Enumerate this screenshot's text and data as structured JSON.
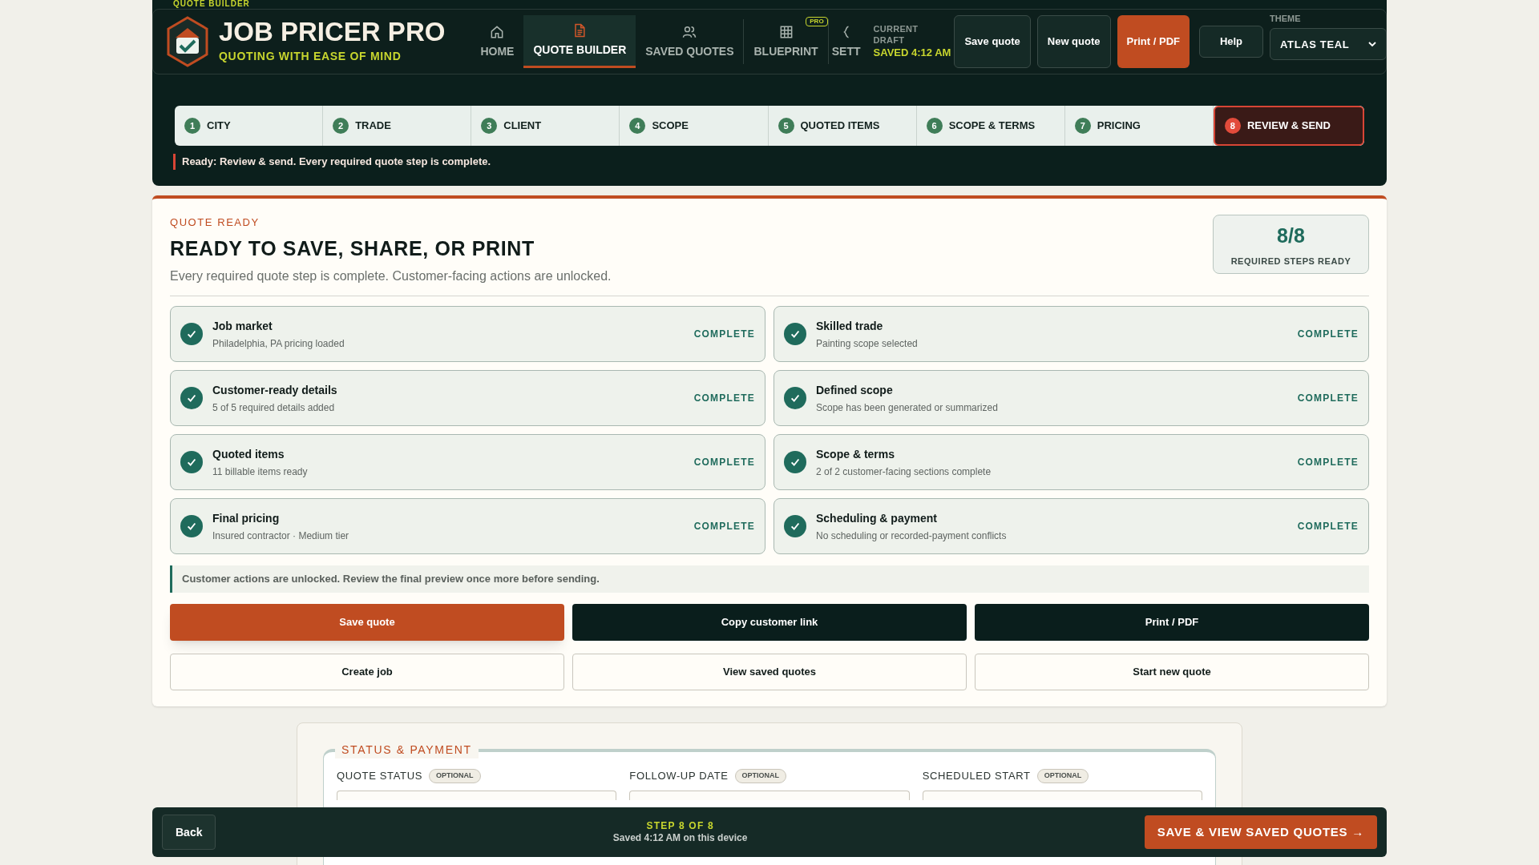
{
  "page_label": "QUOTE BUILDER",
  "header": {
    "brand": "JOB PRICER PRO",
    "tagline": "QUOTING WITH EASE OF MIND",
    "nav": [
      {
        "label": "HOME",
        "selected": false
      },
      {
        "label": "QUOTE BUILDER",
        "selected": true
      },
      {
        "label": "SAVED QUOTES",
        "selected": false
      },
      {
        "label": "BLUEPRINT",
        "selected": false,
        "badge": "PRO"
      },
      {
        "label": "SETT",
        "selected": false
      }
    ],
    "draft": {
      "label": "CURRENT DRAFT",
      "status": "SAVED 4:12 AM"
    },
    "actions": [
      {
        "label": "Save quote",
        "kind": "outline"
      },
      {
        "label": "New quote",
        "kind": "outline"
      },
      {
        "label": "Print / PDF",
        "kind": "primary"
      },
      {
        "label": "Help",
        "kind": "small"
      }
    ],
    "theme": {
      "label": "THEME",
      "value": "ATLAS TEAL"
    }
  },
  "steps": [
    {
      "number": "1",
      "label": "CITY",
      "selected": false
    },
    {
      "number": "2",
      "label": "TRADE",
      "selected": false
    },
    {
      "number": "3",
      "label": "CLIENT",
      "selected": false
    },
    {
      "number": "4",
      "label": "SCOPE",
      "selected": false
    },
    {
      "number": "5",
      "label": "QUOTED ITEMS",
      "selected": false
    },
    {
      "number": "6",
      "label": "SCOPE & TERMS",
      "selected": false
    },
    {
      "number": "7",
      "label": "PRICING",
      "selected": false
    },
    {
      "number": "8",
      "label": "REVIEW & SEND",
      "selected": true
    }
  ],
  "step_message": "Ready: Review & send. Every required quote step is complete.",
  "review": {
    "eyebrow": "QUOTE READY",
    "title": "READY TO SAVE, SHARE, OR PRINT",
    "subtitle": "Every required quote step is complete. Customer-facing actions are unlocked.",
    "summary": {
      "value": "8/8",
      "label": "REQUIRED STEPS READY"
    },
    "checklist": [
      {
        "title": "Job market",
        "detail": "Philadelphia, PA pricing loaded",
        "status": "COMPLETE",
        "checked": true
      },
      {
        "title": "Skilled trade",
        "detail": "Painting scope selected",
        "status": "COMPLETE",
        "checked": true
      },
      {
        "title": "Customer-ready details",
        "detail": "5 of 5 required details added",
        "status": "COMPLETE",
        "checked": true
      },
      {
        "title": "Defined scope",
        "detail": "Scope has been generated or summarized",
        "status": "COMPLETE",
        "checked": true
      },
      {
        "title": "Quoted items",
        "detail": "11 billable items ready",
        "status": "COMPLETE",
        "checked": true
      },
      {
        "title": "Scope & terms",
        "detail": "2 of 2 customer-facing sections complete",
        "status": "COMPLETE",
        "checked": true
      },
      {
        "title": "Final pricing",
        "detail": "Insured contractor · Medium tier",
        "status": "COMPLETE",
        "checked": true
      },
      {
        "title": "Scheduling & payment",
        "detail": "No scheduling or recorded-payment conflicts",
        "status": "COMPLETE",
        "checked": true
      }
    ],
    "notice": "Customer actions are unlocked. Review the final preview once more before sending.",
    "buttons": [
      {
        "label": "Save quote",
        "kind": "primary"
      },
      {
        "label": "Copy customer link",
        "kind": "dark"
      },
      {
        "label": "Print / PDF",
        "kind": "dark"
      },
      {
        "label": "Create job",
        "kind": "outline"
      },
      {
        "label": "View saved quotes",
        "kind": "outline"
      },
      {
        "label": "Start new quote",
        "kind": "outline"
      }
    ]
  },
  "status_payment": {
    "legend": "STATUS & PAYMENT",
    "fields": [
      {
        "label": "QUOTE STATUS",
        "badge": "OPTIONAL"
      },
      {
        "label": "FOLLOW-UP DATE",
        "badge": "OPTIONAL"
      },
      {
        "label": "SCHEDULED START",
        "badge": "OPTIONAL"
      }
    ]
  },
  "footer": {
    "back": "Back",
    "step": "STEP 8 OF 8",
    "saved": "Saved 4:12 AM on this device",
    "next": "SAVE & VIEW SAVED QUOTES →"
  }
}
